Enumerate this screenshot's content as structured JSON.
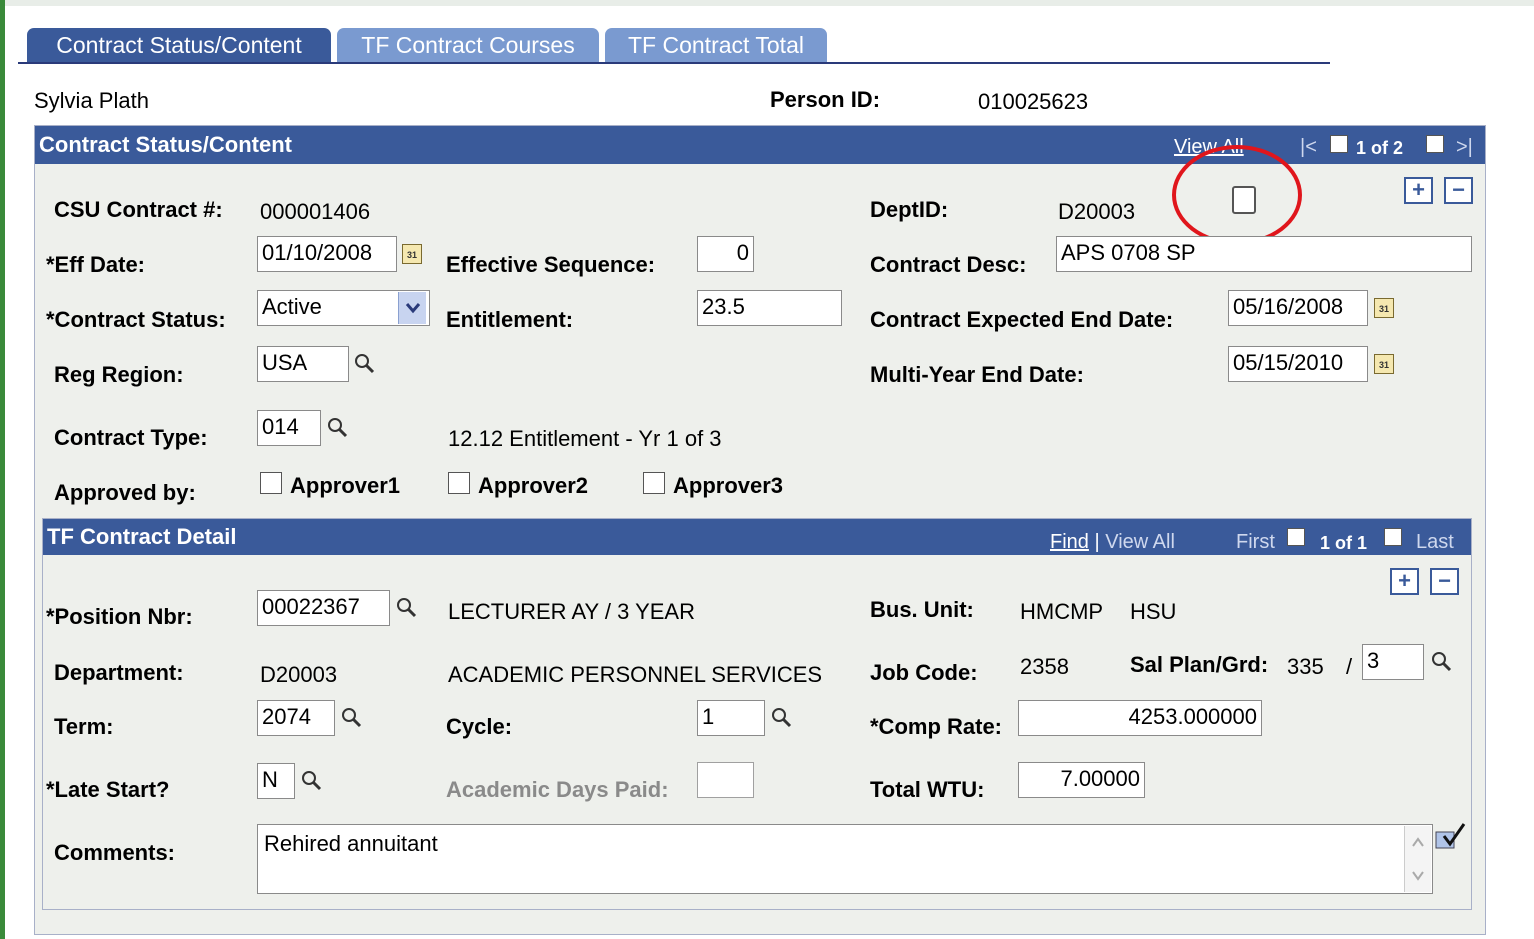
{
  "tabs": [
    {
      "label": "Contract Status/Content"
    },
    {
      "label": "TF Contract Courses"
    },
    {
      "label": "TF Contract Total"
    }
  ],
  "person": {
    "name": "Sylvia Plath",
    "id_label": "Person ID:",
    "id_value": "010025623"
  },
  "status_section": {
    "title": "Contract Status/Content",
    "view_all": "View All",
    "page_info": "1 of 2",
    "csu_contract_label": "CSU Contract #:",
    "csu_contract_value": "000001406",
    "deptid_label": "DeptID:",
    "deptid_value": "D20003",
    "eff_date_label": "*Eff Date:",
    "eff_date_value": "01/10/2008",
    "eff_seq_label": "Effective Sequence:",
    "eff_seq_value": "0",
    "contract_desc_label": "Contract Desc:",
    "contract_desc_value": "APS 0708 SP",
    "contract_status_label": "*Contract Status:",
    "contract_status_value": "Active",
    "entitlement_label": "Entitlement:",
    "entitlement_value": "23.5",
    "expected_end_label": "Contract Expected End Date:",
    "expected_end_value": "05/16/2008",
    "reg_region_label": "Reg Region:",
    "reg_region_value": "USA",
    "multi_year_label": "Multi-Year End Date:",
    "multi_year_value": "05/15/2010",
    "contract_type_label": "Contract Type:",
    "contract_type_value": "014",
    "contract_type_desc": "12.12 Entitlement - Yr 1 of 3",
    "approved_by_label": "Approved by:",
    "approvers": [
      "Approver1",
      "Approver2",
      "Approver3"
    ]
  },
  "detail_section": {
    "title": "TF Contract Detail",
    "find": "Find",
    "sep": "|",
    "view_all": "View All",
    "first": "First",
    "page_info": "1 of 1",
    "last": "Last",
    "position_label": "*Position Nbr:",
    "position_value": "00022367",
    "position_desc": "LECTURER AY / 3 YEAR",
    "bus_unit_label": "Bus. Unit:",
    "bus_unit_value1": "HMCMP",
    "bus_unit_value2": "HSU",
    "department_label": "Department:",
    "department_value": "D20003",
    "department_desc": "ACADEMIC PERSONNEL SERVICES",
    "job_code_label": "Job Code:",
    "job_code_value": "2358",
    "sal_plan_label": "Sal Plan/Grd:",
    "sal_plan_value": "335",
    "sal_sep": "/",
    "grade_value": "3",
    "term_label": "Term:",
    "term_value": "2074",
    "cycle_label": "Cycle:",
    "cycle_value": "1",
    "comp_rate_label": "*Comp Rate:",
    "comp_rate_value": "4253.000000",
    "late_start_label": "*Late Start?",
    "late_start_value": "N",
    "academic_days_label": "Academic Days Paid:",
    "academic_days_value": "",
    "total_wtu_label": "Total WTU:",
    "total_wtu_value": "7.00000",
    "comments_label": "Comments:",
    "comments_value": "Rehired annuitant"
  },
  "colors": {
    "header": "#3a5a9a",
    "annotation_circle": "#e0161c",
    "panel": "#eef0ec"
  }
}
